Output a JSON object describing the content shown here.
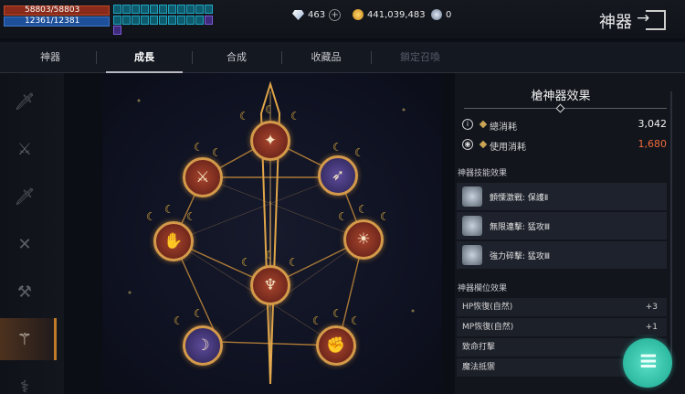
{
  "status": {
    "hp": "58803/58803",
    "mp": "12361/12381"
  },
  "currency": {
    "diamonds": "463",
    "gold": "441,039,483",
    "orbs": "0"
  },
  "header": {
    "title": "神器"
  },
  "tabs": [
    {
      "label": "神器"
    },
    {
      "label": "成長"
    },
    {
      "label": "合成"
    },
    {
      "label": "收藏品"
    },
    {
      "label": "鎖定召喚"
    }
  ],
  "panel": {
    "title": "槍神器效果",
    "total_cost_label": "總消耗",
    "total_cost": "3,042",
    "used_cost_label": "使用消耗",
    "used_cost": "1,680",
    "skills_header": "神器技能效果",
    "skills": [
      {
        "name": "顫慄激戰: 保護Ⅱ"
      },
      {
        "name": "無限連擊: 猛攻Ⅲ"
      },
      {
        "name": "強力碎擊: 猛攻Ⅲ"
      }
    ],
    "slots_header": "神器欄位效果",
    "slot_effects": [
      {
        "name": "HP恢復(自然)",
        "value": "+3"
      },
      {
        "name": "MP恢復(自然)",
        "value": "+1"
      },
      {
        "name": "致命打擊",
        "value": ""
      },
      {
        "name": "魔法抵禦",
        "value": ""
      }
    ]
  },
  "colors": {
    "accent": "#d49a4a",
    "cost_highlight": "#f06a3c",
    "fab": "#19a890"
  }
}
